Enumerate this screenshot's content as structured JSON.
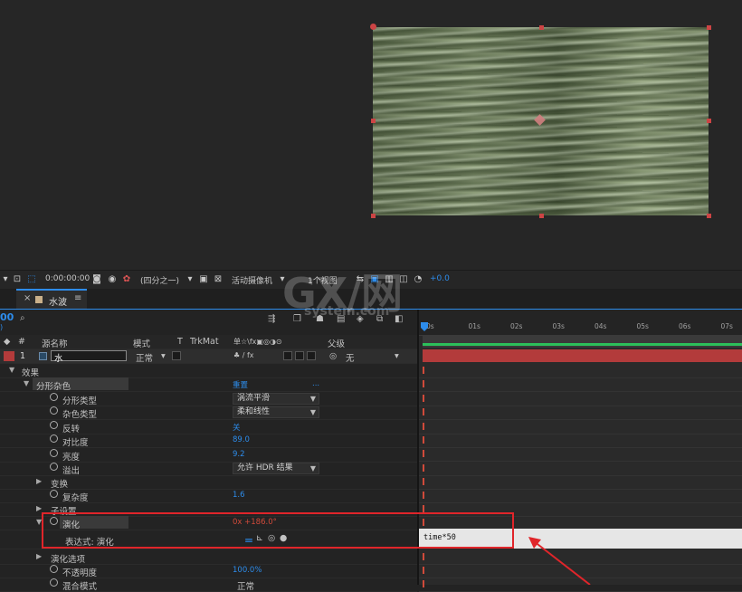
{
  "viewer_toolbar": {
    "timecode": "0:00:00:00",
    "resolution": "(四分之一)",
    "camera": "活动摄像机",
    "views": "1个视图",
    "exposure": "+0.0"
  },
  "tab": {
    "close": "×",
    "name": "水波",
    "menu": "≡"
  },
  "timeline": {
    "current_time_fragment": "00",
    "search_placeholder": "",
    "headers": {
      "num": "#",
      "source_name": "源名称",
      "mode": "模式",
      "t": "T",
      "trkmat": "TrkMat",
      "switches": "单☆\\fx▣◎◑⊙",
      "parent": "父级"
    },
    "layer": {
      "index": "1",
      "name": "水",
      "mode": "正常",
      "parent": "无"
    },
    "effects_label": "效果",
    "effect_name": "分形杂色",
    "reset_label": "重置",
    "ellipsis": "...",
    "properties": [
      {
        "label": "分形类型",
        "value": "涡流平滑",
        "kind": "dropdown"
      },
      {
        "label": "杂色类型",
        "value": "柔和线性",
        "kind": "dropdown"
      },
      {
        "label": "反转",
        "value": "关",
        "kind": "value"
      },
      {
        "label": "对比度",
        "value": "89.0",
        "kind": "value"
      },
      {
        "label": "亮度",
        "value": "9.2",
        "kind": "value"
      },
      {
        "label": "溢出",
        "value": "允许 HDR 结果",
        "kind": "dropdown"
      }
    ],
    "transform_label": "变换",
    "complexity_label": "复杂度",
    "complexity_value": "1.6",
    "sub_settings_label": "子设置",
    "evolution_label": "演化",
    "evolution_value": "0x +186.0°",
    "expression_label": "表达式: 演化",
    "expression_text": "time*50",
    "evolution_options_label": "演化选项",
    "opacity_label": "不透明度",
    "opacity_value": "100.0%",
    "blend_label": "混合模式",
    "blend_value": "正常"
  },
  "ruler": [
    "0s",
    "01s",
    "02s",
    "03s",
    "04s",
    "05s",
    "06s",
    "07s"
  ],
  "watermark": {
    "brand": "GX/网",
    "domain": "system.com"
  },
  "colors": {
    "accent": "#2d8ceb",
    "keyframe": "#d04a3a",
    "callout": "#e0252a",
    "layer_label": "#b33b3b"
  }
}
